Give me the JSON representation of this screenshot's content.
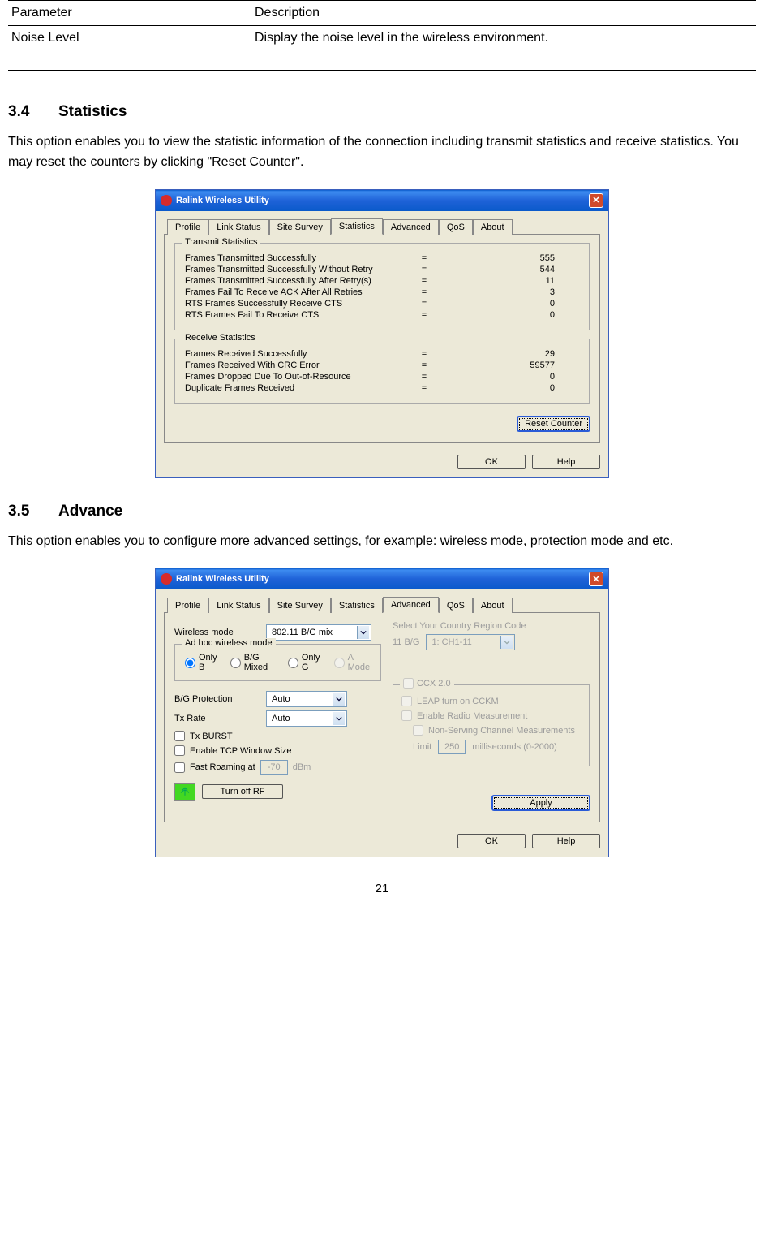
{
  "paramTable": {
    "headers": [
      "Parameter",
      "Description"
    ],
    "rows": [
      {
        "param": "Noise Level",
        "desc": "Display the noise level in the wireless environment."
      }
    ]
  },
  "section34": {
    "num": "3.4",
    "title": "Statistics",
    "body": "This option enables you to view the statistic information of the connection including transmit statistics and receive statistics. You may reset the counters by clicking \"Reset Counter\"."
  },
  "statsWindow": {
    "title": "Ralink Wireless Utility",
    "tabs": [
      "Profile",
      "Link Status",
      "Site Survey",
      "Statistics",
      "Advanced",
      "QoS",
      "About"
    ],
    "activeTab": "Statistics",
    "txLegend": "Transmit Statistics",
    "txRows": [
      {
        "label": "Frames Transmitted Successfully",
        "value": "555"
      },
      {
        "label": "Frames Transmitted Successfully  Without Retry",
        "value": "544"
      },
      {
        "label": "Frames Transmitted Successfully After Retry(s)",
        "value": "11"
      },
      {
        "label": "Frames Fail To Receive ACK After All Retries",
        "value": "3"
      },
      {
        "label": "RTS Frames Successfully Receive CTS",
        "value": "0"
      },
      {
        "label": "RTS Frames Fail To Receive CTS",
        "value": "0"
      }
    ],
    "rxLegend": "Receive Statistics",
    "rxRows": [
      {
        "label": "Frames Received Successfully",
        "value": "29"
      },
      {
        "label": "Frames Received With CRC Error",
        "value": "59577"
      },
      {
        "label": "Frames Dropped Due To Out-of-Resource",
        "value": "0"
      },
      {
        "label": "Duplicate Frames Received",
        "value": "0"
      }
    ],
    "btnReset": "Reset Counter",
    "btnOk": "OK",
    "btnHelp": "Help"
  },
  "section35": {
    "num": "3.5",
    "title": "Advance",
    "body": "This option enables you to configure more advanced settings, for example: wireless mode, protection mode and etc."
  },
  "advWindow": {
    "title": "Ralink Wireless Utility",
    "tabs": [
      "Profile",
      "Link Status",
      "Site Survey",
      "Statistics",
      "Advanced",
      "QoS",
      "About"
    ],
    "activeTab": "Advanced",
    "labels": {
      "wirelessMode": "Wireless mode",
      "wirelessModeVal": "802.11 B/G mix",
      "adhocLegend": "Ad hoc wireless mode",
      "radios": {
        "onlyB": "Only B",
        "bgMixed": "B/G Mixed",
        "onlyG": "Only G",
        "aMode": "A Mode"
      },
      "bgProt": "B/G Protection",
      "bgProtVal": "Auto",
      "txRate": "Tx Rate",
      "txRateVal": "Auto",
      "txBurst": "Tx BURST",
      "tcpWin": "Enable TCP Window Size",
      "fastRoam": "Fast Roaming at",
      "fastRoamVal": "-70",
      "dbm": "dBm",
      "turnOffRF": "Turn off RF",
      "countryLbl": "Select Your Country Region Code",
      "countryBand": "11 B/G",
      "countryVal": "1: CH1-11",
      "ccx": "CCX 2.0",
      "leap": "LEAP turn on CCKM",
      "radioMeas": "Enable Radio Measurement",
      "nonServ": "Non-Serving Channel Measurements",
      "limit": "Limit",
      "limitVal": "250",
      "ms": "milliseconds (0-2000)",
      "apply": "Apply"
    },
    "btnOk": "OK",
    "btnHelp": "Help"
  },
  "pageNumber": "21"
}
